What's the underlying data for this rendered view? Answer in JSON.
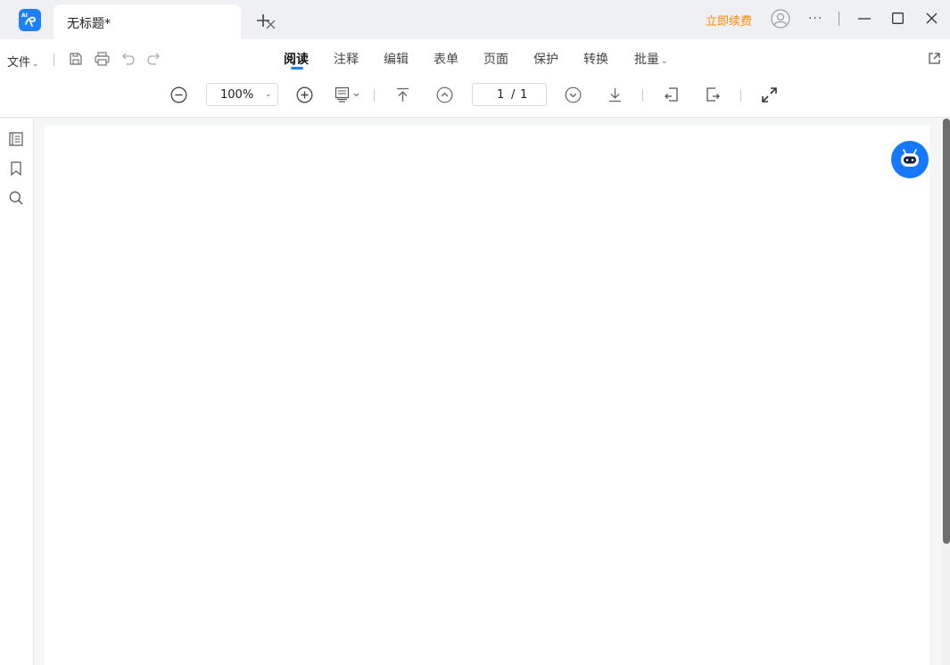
{
  "titlebar": {
    "tab_title": "无标题*",
    "renew_label": "立即续费",
    "more_label": "···"
  },
  "ribbon": {
    "file_label": "文件",
    "tabs": [
      {
        "label": "阅读",
        "active": true
      },
      {
        "label": "注释"
      },
      {
        "label": "编辑"
      },
      {
        "label": "表单"
      },
      {
        "label": "页面"
      },
      {
        "label": "保护"
      },
      {
        "label": "转换"
      },
      {
        "label": "批量"
      }
    ],
    "zoom_value": "100%",
    "page_current": "1",
    "page_separator": "/",
    "page_total": "1"
  },
  "colors": {
    "accent": "#1e80ff",
    "renew": "#ff8a00",
    "ai_button": "#1677ff"
  },
  "icons": {
    "toolbar": [
      "save-icon",
      "print-icon",
      "undo-icon",
      "redo-icon",
      "zoom-out-icon",
      "zoom-in-icon",
      "page-mode-icon",
      "first-page-icon",
      "previous-page-icon",
      "next-page-icon",
      "last-page-icon",
      "rotate-left-icon",
      "rotate-right-icon",
      "fullscreen-icon",
      "open-external-icon"
    ],
    "sidebar": [
      "outline-icon",
      "bookmark-icon",
      "search-icon"
    ]
  }
}
